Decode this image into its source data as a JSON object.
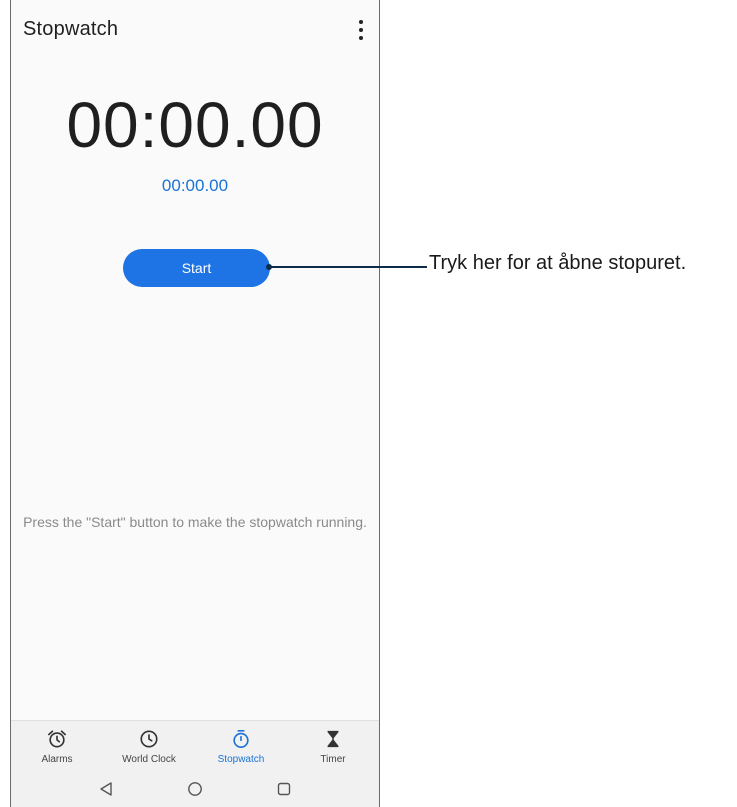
{
  "app": {
    "title": "Stopwatch",
    "menu_icon": "more-vert-icon"
  },
  "stopwatch": {
    "main_time": "00:00.00",
    "lap_time": "00:00.00",
    "start_label": "Start",
    "hint": "Press the \"Start\" button to make the stopwatch running."
  },
  "bottom_nav": {
    "items": [
      {
        "label": "Alarms",
        "icon": "alarm-icon",
        "active": false
      },
      {
        "label": "World Clock",
        "icon": "clock-icon",
        "active": false
      },
      {
        "label": "Stopwatch",
        "icon": "stopwatch-icon",
        "active": true
      },
      {
        "label": "Timer",
        "icon": "hourglass-icon",
        "active": false
      }
    ]
  },
  "system_nav": {
    "back_icon": "back-triangle-icon",
    "home_icon": "home-circle-icon",
    "recents_icon": "recents-square-icon"
  },
  "callout": {
    "text": "Tryk her for at åbne stopuret."
  },
  "colors": {
    "accent": "#1e74e4",
    "accent_text": "#1a73d6",
    "callout_line": "#0b2d4a"
  }
}
